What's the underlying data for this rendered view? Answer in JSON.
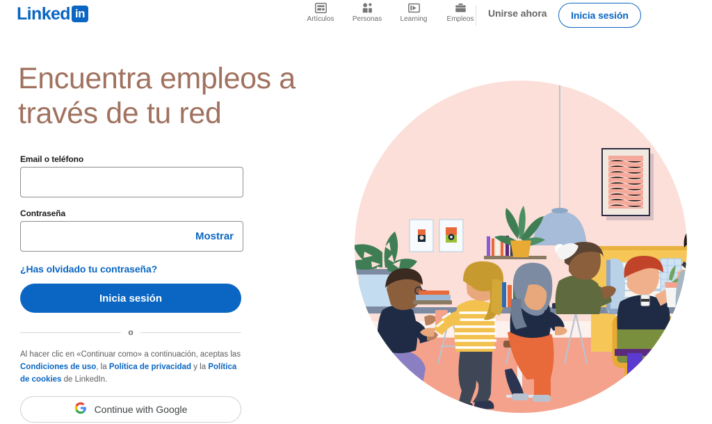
{
  "header": {
    "logo": {
      "word": "Linked",
      "badge": "in",
      "name": "linkedin-logo"
    },
    "nav": [
      {
        "label": "Artículos",
        "icon": "article-icon"
      },
      {
        "label": "Personas",
        "icon": "people-icon"
      },
      {
        "label": "Learning",
        "icon": "learning-icon"
      },
      {
        "label": "Empleos",
        "icon": "jobs-briefcase-icon"
      }
    ],
    "join_now": "Unirse ahora",
    "sign_in": "Inicia sesión"
  },
  "hero": {
    "title": "Encuentra empleos a través de tu red"
  },
  "form": {
    "email_label": "Email o teléfono",
    "email_value": "",
    "email_placeholder": "",
    "password_label": "Contraseña",
    "password_value": "",
    "password_placeholder": "",
    "show_label": "Mostrar",
    "forgot_password": "¿Has olvidado tu contraseña?",
    "submit_label": "Inicia sesión",
    "divider_label": "o",
    "legal_prefix": "Al hacer clic en «Continuar como» a continuación, aceptas las ",
    "legal_terms": "Condiciones de uso",
    "legal_mid1": ", la ",
    "legal_privacy": "Política de privacidad",
    "legal_mid2": " y la ",
    "legal_cookies": "Política de cookies",
    "legal_suffix": " de LinkedIn.",
    "google_label": "Continue with Google"
  },
  "colors": {
    "brand_blue": "#0a66c2",
    "hero_text": "#a0725f",
    "illustration_circle": "#fbdfd8",
    "illustration_floor": "#f4a28c"
  },
  "illustration": {
    "name": "office-collaboration-illustration",
    "alt": "Ilustración de personas trabajando juntas en una oficina"
  }
}
